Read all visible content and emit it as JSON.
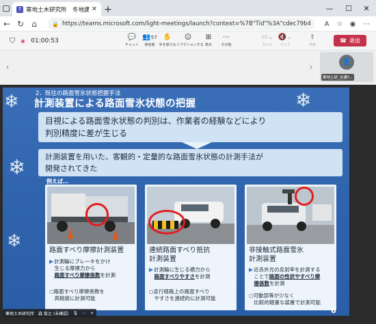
{
  "browser": {
    "tab_title": "寒地土木研究所　冬地講習会 | M",
    "url": "https://teams.microsoft.com/light-meetings/launch?context=%7B\"Tid\"%3A\"cdec79b4-6c91-4d03-bccf-b47...",
    "url_icon": "lock-icon"
  },
  "teams": {
    "timer": "01:00:53",
    "participants_count": "57",
    "tools": [
      {
        "id": "chat",
        "label": "チャット",
        "icon": "chat-icon"
      },
      {
        "id": "people",
        "label": "参加者",
        "icon": "people-icon"
      },
      {
        "id": "raise",
        "label": "手を挙げる",
        "icon": "hand-icon"
      },
      {
        "id": "react",
        "label": "リアクションする",
        "icon": "emoji-icon"
      },
      {
        "id": "view",
        "label": "表示",
        "icon": "grid-icon"
      },
      {
        "id": "more",
        "label": "その他",
        "icon": "more-icon"
      },
      {
        "id": "camera",
        "label": "カメラ",
        "icon": "camera-icon"
      },
      {
        "id": "mic",
        "label": "マイク",
        "icon": "mic-icon"
      },
      {
        "id": "share",
        "label": "共有",
        "icon": "share-icon"
      }
    ],
    "leave_label": "退出",
    "leave_color": "#c4314b"
  },
  "participant": {
    "tile_name": "寒地土研_交通T..."
  },
  "slide": {
    "section": "2．既往の路面雪氷状態把握手法",
    "heading": "計測装置による路面雪氷状態の把握",
    "box1_line1": "目視による路面雪氷状態の判別は、作業者の経験などにより",
    "box1_line2": "判別精度に差が生じる",
    "box2_line1": "計測装置を用いた、客観的・定量的な路面雪氷状態の計測手法が",
    "box2_line2": "開発されてきた",
    "example": "例えば…",
    "cards": [
      {
        "title": "路面すべり摩擦計測装置",
        "desc_a": "計測輪にブレーキをかけ",
        "desc_b": "生じる摩擦力から",
        "desc_c": "路面すべり摩擦係数",
        "desc_d": "を計測",
        "foot_a": "○路面すべり摩擦係数を",
        "foot_b": "　高精度に計測可能"
      },
      {
        "title": "連続路面すべり抵抗",
        "title2": "計測装置",
        "desc_a": "計測輪に生じる横力から",
        "desc_c": "路面すべりやすさ",
        "desc_d": "を計測",
        "foot_a": "○走行経路上の路面すべり",
        "foot_b": "　やすさを連続的に計測可能"
      },
      {
        "title": "非接触式路面雪氷",
        "title2": "計測装置",
        "desc_a": "近赤外光の反射率を計測する",
        "desc_b": "ことで",
        "desc_c": "路面の性状やすべり摩",
        "desc_c2": "擦係数",
        "desc_d": "を計測",
        "foot_a": "○可動部等が少なく",
        "foot_b": "　比較的軽量な装置で計測可能"
      }
    ],
    "page_number": "6"
  },
  "presenter": {
    "org": "寒地土木研究所",
    "name": "森 俊之 (未確認)"
  }
}
